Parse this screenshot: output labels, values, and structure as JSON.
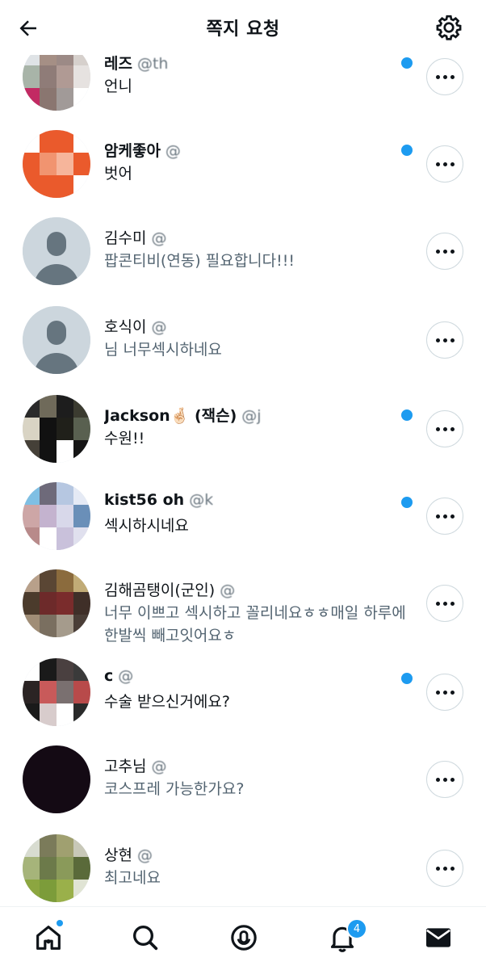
{
  "header": {
    "title": "쪽지 요청"
  },
  "requests": [
    {
      "name": "레즈",
      "handle": "@th",
      "message": "언니",
      "unread": true,
      "avatar_colors": [
        "#dfe3e6",
        "#a58f85",
        "#9c8a86",
        "#d6d0cc",
        "#a8b4a8",
        "#8f7c78",
        "#b09a94",
        "#e6e2e0",
        "#c22a63",
        "#8a7670",
        "#a19a98",
        "#ffffff"
      ]
    },
    {
      "name": "암케좋아",
      "handle": "@",
      "message": "벗어",
      "unread": true,
      "avatar_colors": [
        "#ffffff",
        "#ea5a2c",
        "#ea5a2c",
        "#ffffff",
        "#ea5a2c",
        "#f19470",
        "#f6b59b",
        "#ea5a2c",
        "#ea5a2c",
        "#ea5a2c",
        "#ea5a2c",
        "#ffffff"
      ]
    },
    {
      "name": "김수미",
      "handle": "@",
      "message": "팝콘티비(연동) 필요합니다!!!",
      "unread": false,
      "avatar_colors": []
    },
    {
      "name": "호식이",
      "handle": "@",
      "message": "님 너무섹시하네요",
      "unread": false,
      "avatar_colors": []
    },
    {
      "name": "Jackson🤞🏻 (잭슨)",
      "handle": "@j",
      "message": "수원!!",
      "unread": true,
      "avatar_colors": [
        "#2a2a2a",
        "#6f6a5a",
        "#1d1d1d",
        "#3b3b30",
        "#d9d4c4",
        "#111111",
        "#20201a",
        "#596050",
        "#454038",
        "#121212",
        "#ffffff",
        "#151515"
      ]
    },
    {
      "name": "kist56 oh",
      "handle": "@k",
      "message": "섹시하시네요",
      "unread": true,
      "avatar_colors": [
        "#7fbfe3",
        "#6e6a7a",
        "#b6c7e1",
        "#e5eaf5",
        "#cda6a6",
        "#c4b3cf",
        "#d8d8ea",
        "#6a8fb8",
        "#b88a8a",
        "#ffffff",
        "#c9c1db",
        "#e0e0ee"
      ]
    },
    {
      "name": "김해곰탱이(군인)",
      "handle": "@",
      "message": "너무 이쁘고 섹시하고 꼴리네요ㅎㅎ매일 하루에 한발씩 빼고잇어요ㅎ",
      "unread": false,
      "avatar_colors": [
        "#b8a08a",
        "#5a4634",
        "#8b6b3d",
        "#c1ab76",
        "#4b3b2c",
        "#6d2a2a",
        "#7a2c2c",
        "#3f2f28",
        "#a08d76",
        "#7a6f60",
        "#a59b8c",
        "#4a3e37"
      ]
    },
    {
      "name": "c",
      "handle": "@",
      "message": "수술 받으신거에요?",
      "unread": true,
      "avatar_colors": [
        "#ffffff",
        "#1a1a1a",
        "#4a4040",
        "#3a3a3a",
        "#2b2424",
        "#c85a5a",
        "#7a7070",
        "#b84a4a",
        "#1a1a1a",
        "#d8cccc",
        "#ffffff",
        "#2a2a2a"
      ]
    },
    {
      "name": "고추님",
      "handle": "@",
      "message": "코스프레 가능한가요?",
      "unread": false,
      "avatar_colors": [
        "#140a14",
        "#140a14",
        "#140a14",
        "#140a14",
        "#140a14",
        "#140a14",
        "#140a14",
        "#140a14",
        "#140a14",
        "#140a14",
        "#140a14",
        "#140a14"
      ]
    },
    {
      "name": "상현",
      "handle": "@",
      "message": "최고네요",
      "unread": false,
      "avatar_colors": [
        "#d8dcd0",
        "#7b7b5a",
        "#a0a070",
        "#c8c8b8",
        "#a6b47a",
        "#6c7a4a",
        "#8a9a5a",
        "#5a6a3a",
        "#8ca640",
        "#7c9c3a",
        "#9ab04a",
        "#e0e4d4"
      ]
    }
  ],
  "notifications_badge": "4",
  "icons": {
    "back": "back-arrow-icon",
    "settings": "gear-icon",
    "more": "more-horizontal-icon",
    "home": "home-icon",
    "search": "search-icon",
    "spaces": "spaces-microphone-icon",
    "notifications": "bell-icon",
    "messages": "envelope-icon"
  },
  "colors": {
    "unread_dot": "#1d9bf0",
    "secondary_text": "#536471"
  }
}
